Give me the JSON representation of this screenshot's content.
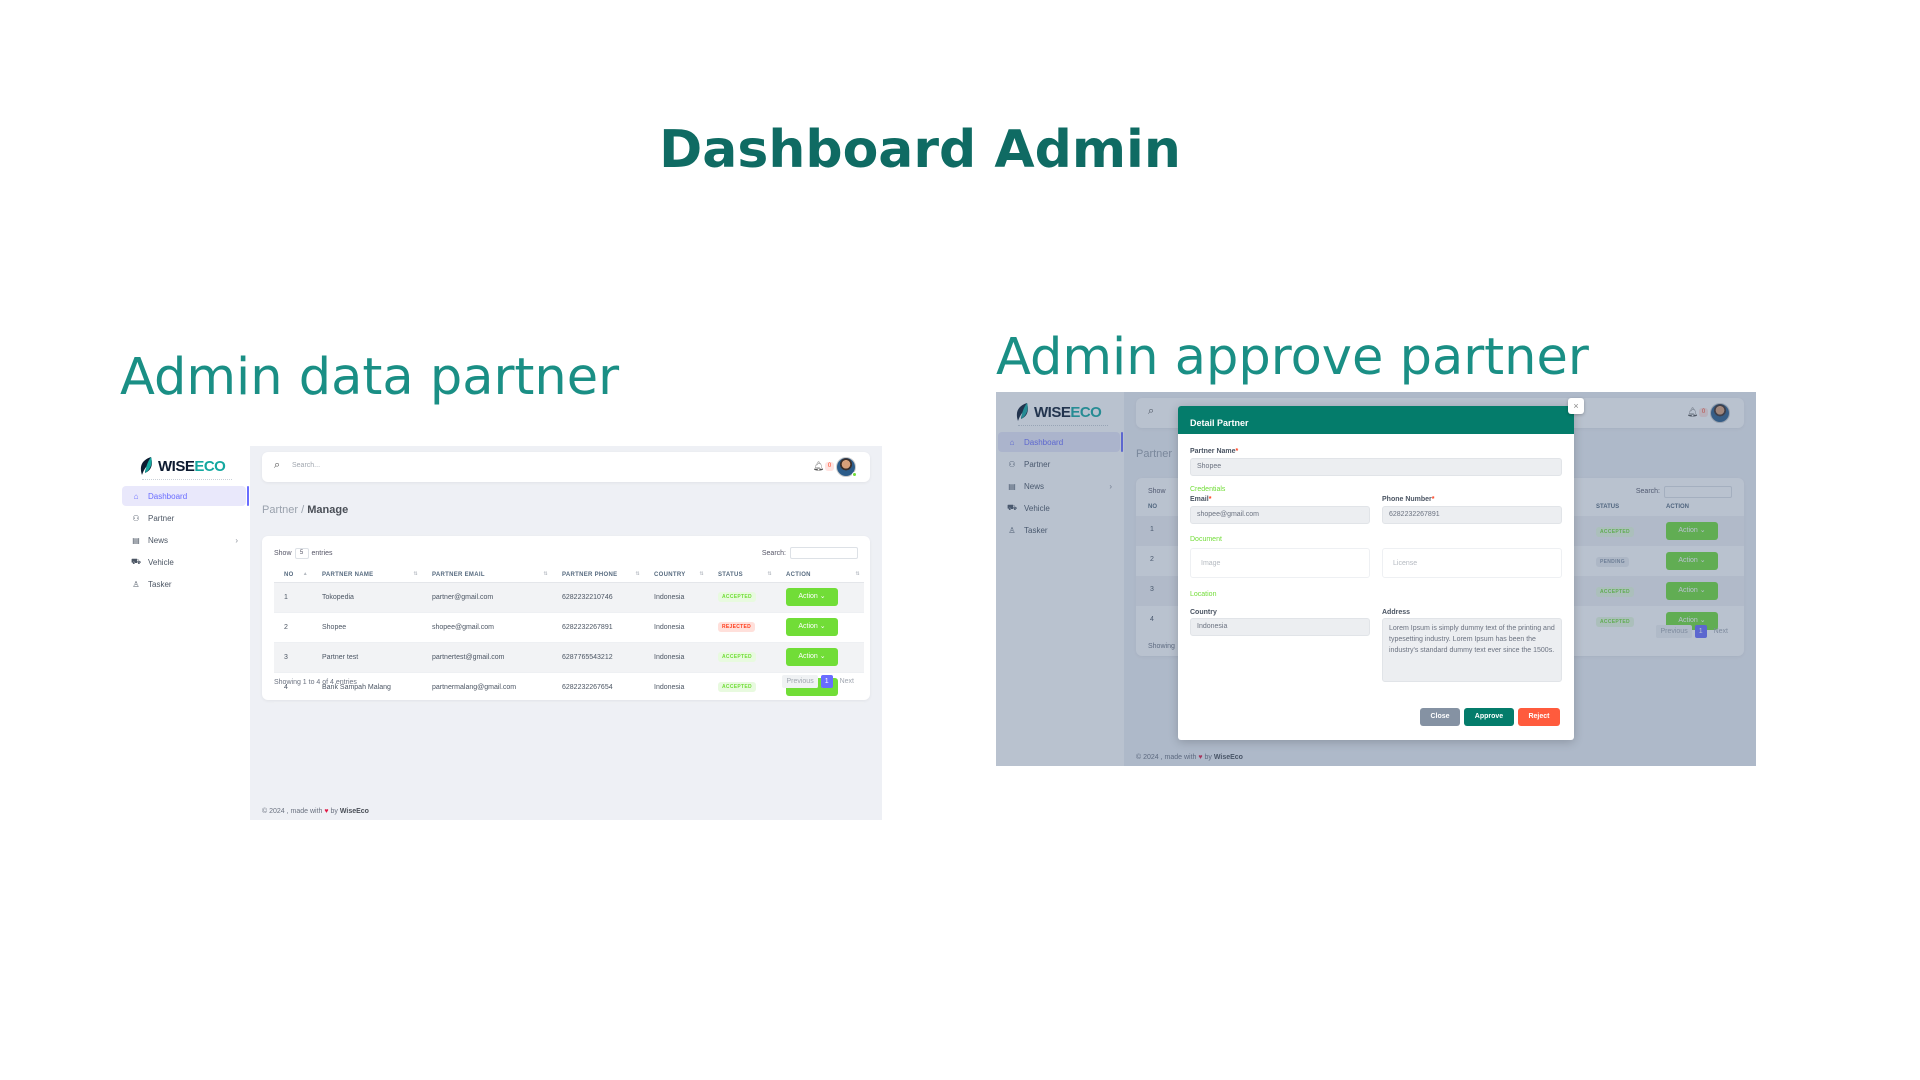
{
  "page": {
    "title": "Dashboard Admin",
    "left_caption": "Admin data partner",
    "right_caption": "Admin approve partner"
  },
  "brand": {
    "name_a": "WISE",
    "name_b": "ECO"
  },
  "sidebar": {
    "items": [
      {
        "label": "Dashboard",
        "icon": "home-icon",
        "glyph": "⌂"
      },
      {
        "label": "Partner",
        "icon": "user-icon",
        "glyph": "⚇"
      },
      {
        "label": "News",
        "icon": "news-icon",
        "glyph": "▤"
      },
      {
        "label": "Vehicle",
        "icon": "truck-icon",
        "glyph": "⛟"
      },
      {
        "label": "Tasker",
        "icon": "person-icon",
        "glyph": "♙"
      }
    ]
  },
  "topbar": {
    "search_placeholder": "Search...",
    "notification_count": "0"
  },
  "breadcrumb": {
    "parent": "Partner / ",
    "current": "Manage"
  },
  "table": {
    "show_label": "Show",
    "show_value": "5",
    "entries_label": "entries",
    "search_label": "Search:",
    "columns": [
      "NO",
      "PARTNER NAME",
      "PARTNER EMAIL",
      "PARTNER PHONE",
      "COUNTRY",
      "STATUS",
      "ACTION"
    ],
    "rows": [
      {
        "no": "1",
        "name": "Tokopedia",
        "email": "partner@gmail.com",
        "phone": "6282232210746",
        "country": "Indonesia",
        "status": "ACCEPTED",
        "action": "Action ⌄"
      },
      {
        "no": "2",
        "name": "Shopee",
        "email": "shopee@gmail.com",
        "phone": "6282232267891",
        "country": "Indonesia",
        "status": "REJECTED",
        "action": "Action ⌄"
      },
      {
        "no": "3",
        "name": "Partner test",
        "email": "partnertest@gmail.com",
        "phone": "6287765543212",
        "country": "Indonesia",
        "status": "ACCEPTED",
        "action": "Action ⌄"
      },
      {
        "no": "4",
        "name": "Bank Sampah Malang",
        "email": "partnermalang@gmail.com",
        "phone": "6282232267654",
        "country": "Indonesia",
        "status": "ACCEPTED",
        "action": "Action ⌄"
      }
    ],
    "info": "Showing 1 to 4 of 4 entries",
    "pagination": {
      "prev": "Previous",
      "current": "1",
      "next": "Next"
    }
  },
  "right_panel": {
    "breadcrumb": "Partner",
    "show_label": "Show",
    "search_label": "Search:",
    "columns": [
      "NO",
      "STATUS",
      "ACTION"
    ],
    "rows": [
      {
        "no": "1",
        "status": "ACCEPTED",
        "action": "Action ⌄"
      },
      {
        "no": "2",
        "status": "PENDING",
        "action": "Action ⌄"
      },
      {
        "no": "3",
        "status": "ACCEPTED",
        "action": "Action ⌄"
      },
      {
        "no": "4",
        "status": "ACCEPTED",
        "action": "Action ⌄"
      }
    ],
    "info": "Showing",
    "pagination": {
      "prev": "Previous",
      "current": "1",
      "next": "Next"
    }
  },
  "modal": {
    "title": "Detail Partner",
    "close_glyph": "×",
    "partner_name_label": "Partner Name",
    "partner_name_value": "Shopee",
    "credentials_label": "Credentials",
    "email_label": "Email",
    "email_value": "shopee@gmail.com",
    "phone_label": "Phone Number",
    "phone_value": "6282232267891",
    "document_label": "Document",
    "image_label": "Image",
    "license_label": "License",
    "location_label": "Location",
    "country_label": "Country",
    "country_value": "Indonesia",
    "address_label": "Address",
    "address_value": "Lorem Ipsum is simply dummy text of the printing and typesetting industry. Lorem Ipsum has been the industry's standard dummy text ever since the 1500s.",
    "buttons": {
      "close": "Close",
      "approve": "Approve",
      "reject": "Reject"
    }
  },
  "footer": {
    "prefix": "© 2024 , made with",
    "by": "by",
    "brand": "WiseEco"
  },
  "colors": {
    "primary": "#696cff",
    "brand": "#047c6b",
    "success": "#71dd37",
    "danger": "#ff3e1d",
    "title": "#0f6b63"
  }
}
